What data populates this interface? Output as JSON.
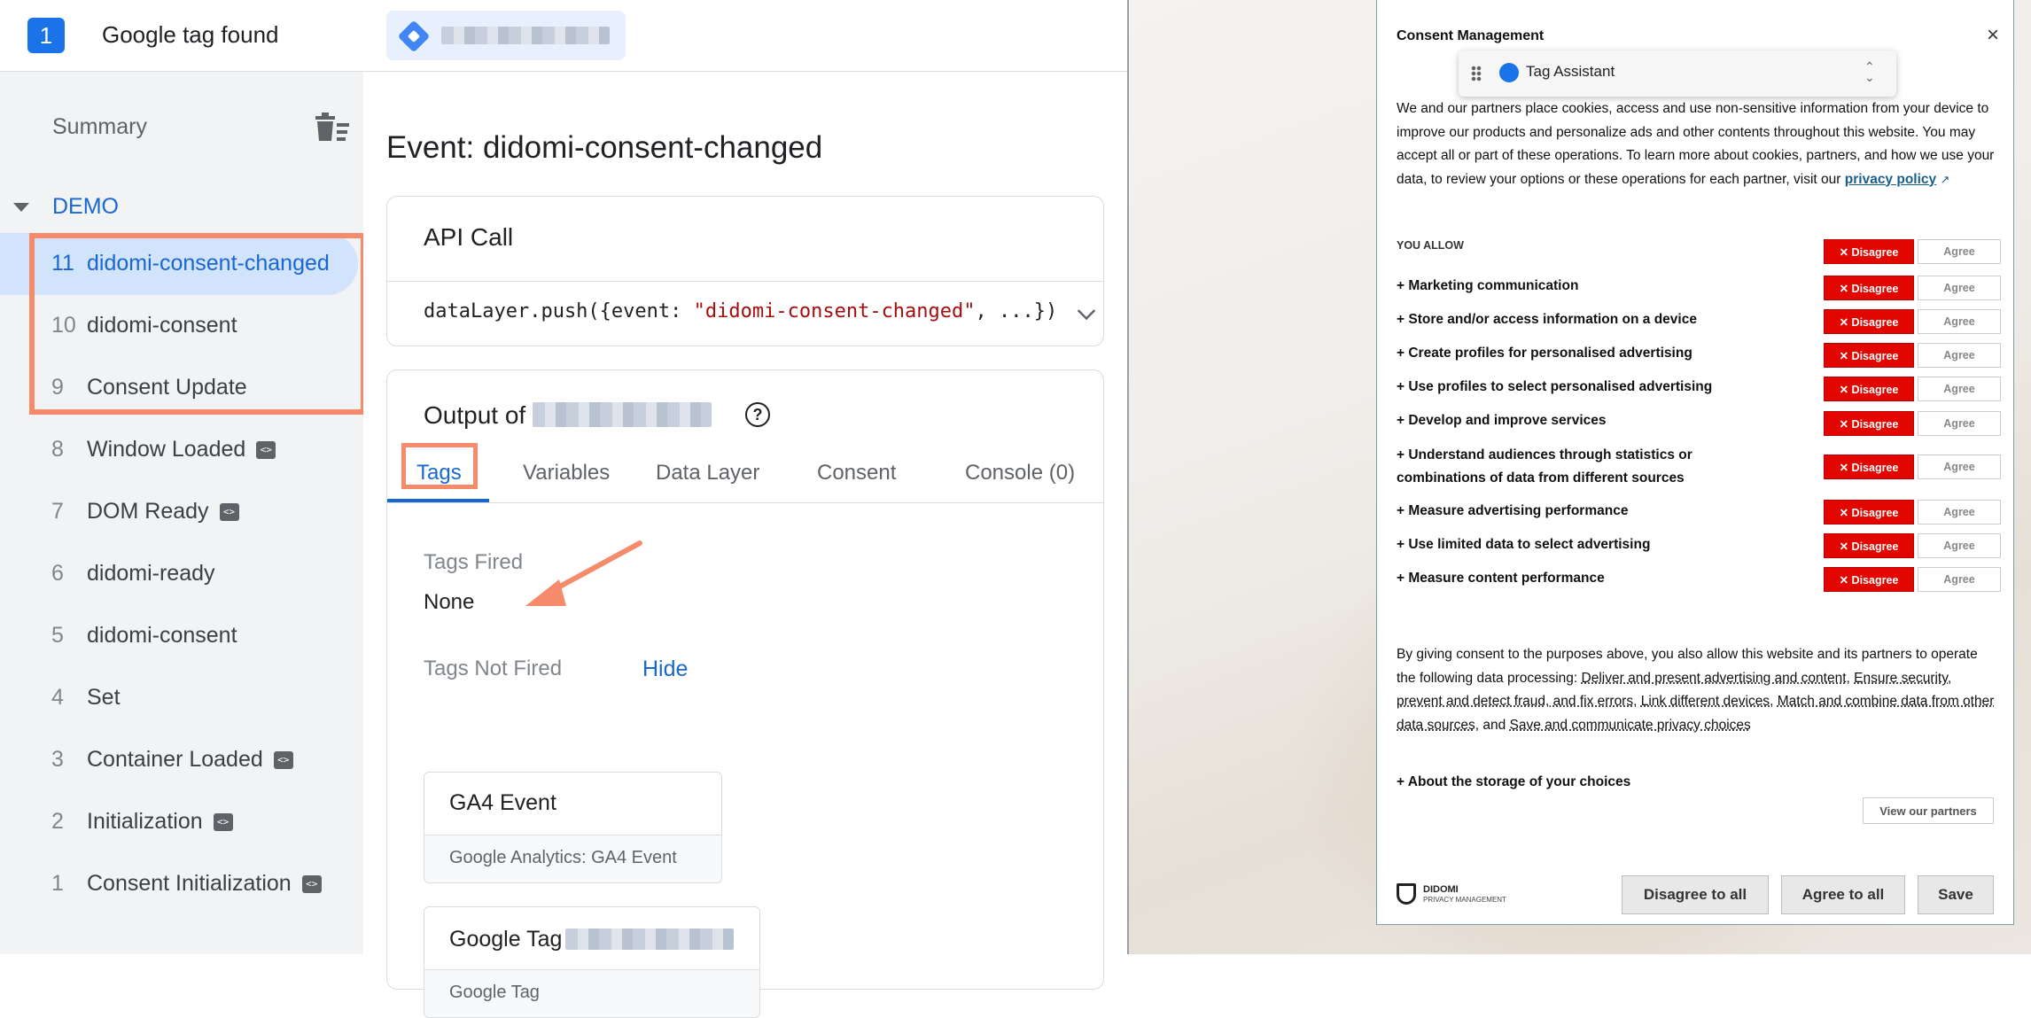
{
  "header": {
    "tag_count": "1",
    "tag_found": "Google tag found"
  },
  "sidebar": {
    "summary": "Summary",
    "group": "DEMO",
    "events": [
      {
        "num": "11",
        "name": "didomi-consent-changed",
        "code": false
      },
      {
        "num": "10",
        "name": "didomi-consent",
        "code": false
      },
      {
        "num": "9",
        "name": "Consent Update",
        "code": false
      },
      {
        "num": "8",
        "name": "Window Loaded",
        "code": true
      },
      {
        "num": "7",
        "name": "DOM Ready",
        "code": true
      },
      {
        "num": "6",
        "name": "didomi-ready",
        "code": false
      },
      {
        "num": "5",
        "name": "didomi-consent",
        "code": false
      },
      {
        "num": "4",
        "name": "Set",
        "code": false
      },
      {
        "num": "3",
        "name": "Container Loaded",
        "code": true
      },
      {
        "num": "2",
        "name": "Initialization",
        "code": true
      },
      {
        "num": "1",
        "name": "Consent Initialization",
        "code": true
      }
    ]
  },
  "main": {
    "event_title": "Event: didomi-consent-changed",
    "api_title": "API Call",
    "api_code_prefix": "dataLayer.push({event: ",
    "api_code_string": "\"didomi-consent-changed\"",
    "api_code_suffix": ", ...})",
    "output_title": "Output of",
    "tabs": [
      "Tags",
      "Variables",
      "Data Layer",
      "Consent",
      "Console (0)"
    ],
    "tags_fired_label": "Tags Fired",
    "tags_fired_value": "None",
    "tags_not_fired_label": "Tags Not Fired",
    "hide_link": "Hide",
    "not_fired": [
      {
        "title": "GA4 Event",
        "subtitle": "Google Analytics: GA4 Event"
      },
      {
        "title": "Google Tag",
        "subtitle": "Google Tag"
      }
    ]
  },
  "consent": {
    "title": "Consent Management",
    "close": "×",
    "tag_assistant": "Tag Assistant",
    "intro": "We and our partners place cookies, access and use non-sensitive information from your device to improve our products and personalize ads and other contents throughout this website. You may accept all or part of these operations. To learn more about cookies, partners, and how we use your data, to review your options or these operations for each partner, visit our",
    "privacy_link": "privacy policy",
    "you_allow": "YOU ALLOW",
    "disagree": "✕ Disagree",
    "agree": "Agree",
    "purposes": [
      "+ Marketing communication",
      "+ Store and/or access information on a device",
      "+ Create profiles for personalised advertising",
      "+ Use profiles to select personalised advertising",
      "+ Develop and improve services",
      "+ Understand audiences through statistics or combinations of data from different sources",
      "+ Measure advertising performance",
      "+ Use limited data to select advertising",
      "+ Measure content performance"
    ],
    "bottom_prefix": "By giving consent to the purposes above, you also allow this website and its partners to operate the following data processing:",
    "bottom_links": [
      "Deliver and present advertising and content",
      "Ensure security, prevent and detect fraud, and fix errors",
      "Link different devices",
      "Match and combine data from other data sources",
      "Save and communicate privacy choices"
    ],
    "storage": "+ About the storage of your choices",
    "view_partners": "View our partners",
    "brand": "DIDOMI",
    "brand_sub": "PRIVACY MANAGEMENT",
    "btn_disagree_all": "Disagree to all",
    "btn_agree_all": "Agree to all",
    "btn_save": "Save"
  }
}
